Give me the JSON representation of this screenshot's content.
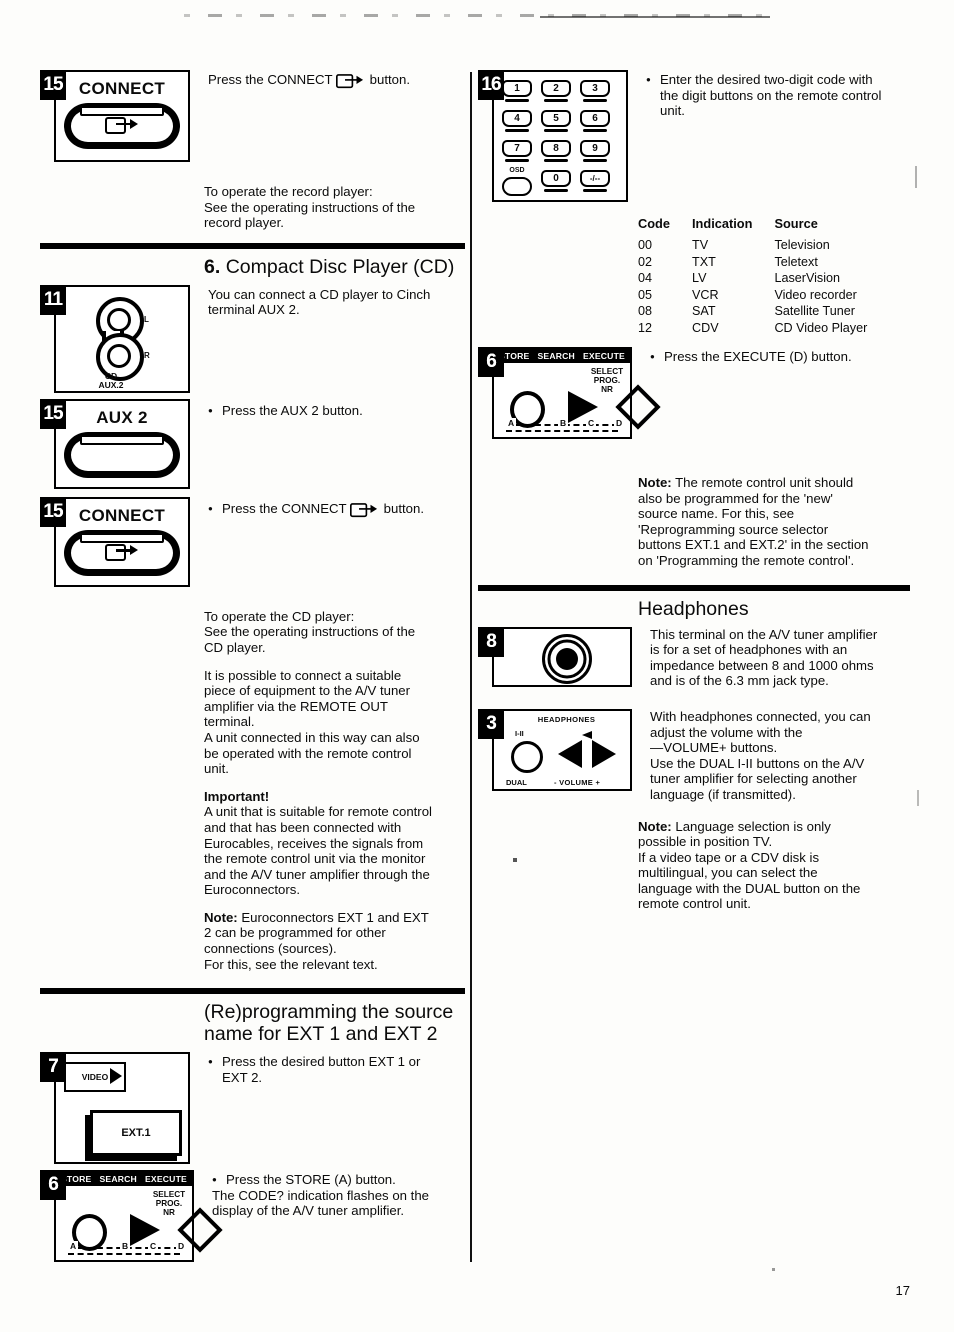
{
  "page": {
    "number": "17"
  },
  "left_column": {
    "step_connect_record": {
      "badge": "15",
      "button_label": "CONNECT",
      "instruction_prefix": "Press the CONNECT ",
      "instruction_suffix": " button."
    },
    "record_player_note": "To operate the record player:\nSee the operating instructions of the\nrecord player.",
    "section_cd": {
      "number": "6.",
      "title": "Compact Disc Player (CD)",
      "intro": "You can connect a CD player to Cinch\nterminal AUX 2.",
      "jack_panel": {
        "badge": "11",
        "label_left": "L",
        "label_right": "R",
        "caption_line1": "CD",
        "caption_line2": "AUX.2"
      },
      "step_aux2": {
        "badge": "15",
        "button_label": "AUX 2",
        "instruction": "Press the AUX 2 button."
      },
      "step_connect": {
        "badge": "15",
        "button_label": "CONNECT",
        "instruction_prefix": "Press the CONNECT ",
        "instruction_suffix": " button."
      },
      "operate_note": "To operate the CD player:\nSee the operating instructions of the\nCD player.",
      "remote_out_note": "It is possible to connect a suitable\npiece of equipment to the A/V tuner\namplifier via the REMOTE OUT\nterminal.\nA unit connected in this way can also\nbe operated with the remote control\nunit.",
      "important_heading": "Important!",
      "important_body": "A unit that is suitable for remote control\nand that has been connected with\nEurocables, receives the signals from\nthe remote control unit via the monitor\nand the A/V tuner amplifier through the\nEuroconnectors.",
      "note_label": "Note:",
      "note_body": " Euroconnectors EXT 1 and EXT\n2 can be programmed for other\nconnections (sources).\nFor this, see the relevant text."
    },
    "section_reprogram": {
      "title_line1": "(Re)programming the source",
      "title_line2": "name for EXT 1 and EXT 2",
      "step_ext": {
        "badge": "7",
        "video_button_label": "VIDEO",
        "display_label": "EXT.1",
        "instruction": "Press the desired button EXT 1 or\nEXT 2."
      },
      "step_store": {
        "badge": "6",
        "panel": {
          "store": "STORE",
          "search": "SEARCH",
          "execute": "EXECUTE",
          "select": "SELECT",
          "prog": "PROG.",
          "nr": "NR",
          "a": "A",
          "b": "B",
          "c": "C",
          "d": "D"
        },
        "instruction_bullet": "Press the STORE (A) button.",
        "instruction_rest": "The CODE? indication flashes on the\ndisplay of the A/V tuner amplifier."
      }
    }
  },
  "right_column": {
    "step_keypad": {
      "badge": "16",
      "keys": [
        "1",
        "2",
        "3",
        "4",
        "5",
        "6",
        "7",
        "8",
        "9",
        "0"
      ],
      "osd_label": "OSD",
      "dash_key_label": "-/--",
      "instruction": "Enter the desired two-digit code with\nthe digit buttons on the remote control\nunit."
    },
    "code_table": {
      "headers": [
        "Code",
        "Indication",
        "Source"
      ],
      "rows": [
        [
          "00",
          "TV",
          "Television"
        ],
        [
          "02",
          "TXT",
          "Teletext"
        ],
        [
          "04",
          "LV",
          "LaserVision"
        ],
        [
          "05",
          "VCR",
          "Video recorder"
        ],
        [
          "08",
          "SAT",
          "Satellite Tuner"
        ],
        [
          "12",
          "CDV",
          "CD Video Player"
        ]
      ]
    },
    "step_execute": {
      "badge": "6",
      "panel": {
        "store": "STORE",
        "search": "SEARCH",
        "execute": "EXECUTE",
        "select": "SELECT",
        "prog": "PROG.",
        "nr": "NR",
        "a": "A",
        "b": "B",
        "c": "C",
        "d": "D"
      },
      "instruction": "Press the EXECUTE (D) button."
    },
    "execute_note": {
      "label": "Note:",
      "body": " The remote control unit should\nalso be programmed for the 'new'\nsource name. For this, see\n'Reprogramming source selector\nbuttons EXT.1 and EXT.2' in the section\non 'Programming the remote control'."
    },
    "section_headphones": {
      "title": "Headphones",
      "jack_step": {
        "badge": "8",
        "body": "This terminal on the A/V tuner amplifier\nis for a set of headphones with an\nimpedance between 8 and 1000 ohms\nand is of the 6.3 mm jack type."
      },
      "dual_step": {
        "badge": "3",
        "panel": {
          "headphones_label": "HEADPHONES",
          "dual_label": "DUAL",
          "dual_mode": "I-II",
          "volume_label": "- VOLUME +"
        },
        "body": "With headphones connected, you can\nadjust the volume with the\n—VOLUME+ buttons.\nUse the DUAL I-II buttons on the A/V\ntuner amplifier for selecting another\nlanguage (if transmitted)."
      },
      "note": {
        "label": "Note:",
        "body": " Language selection is only\npossible in position TV.\nIf a video tape or a CDV disk is\nmultilingual, you can select the\nlanguage with the DUAL button on the\nremote control unit."
      }
    }
  }
}
